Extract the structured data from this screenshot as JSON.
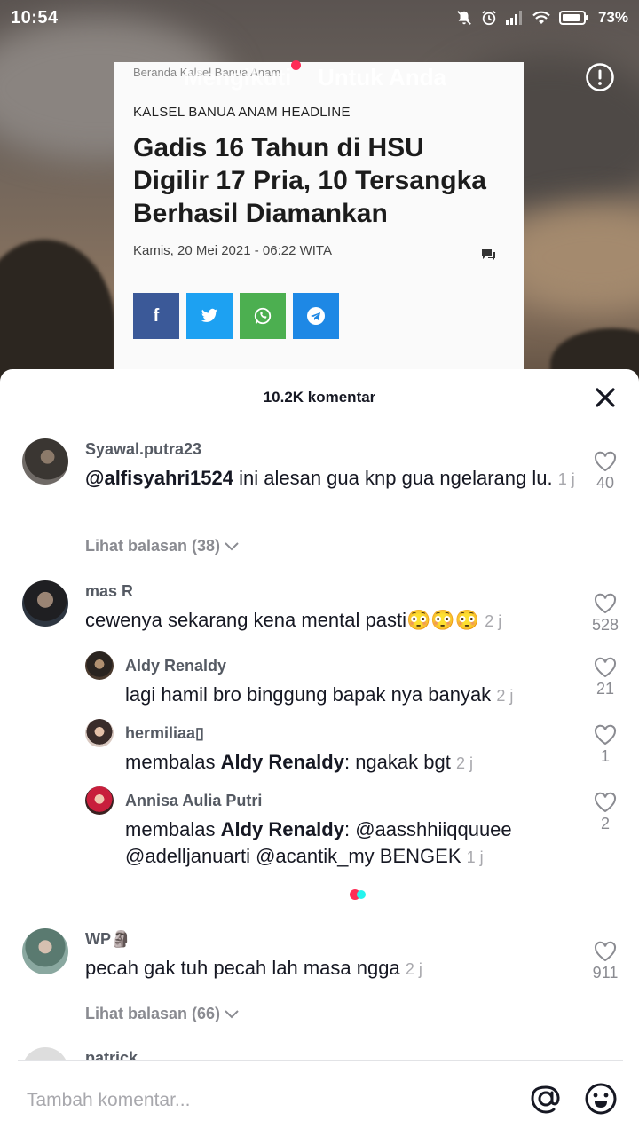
{
  "status_bar": {
    "time": "10:54",
    "battery": "73%",
    "icons": [
      "mute-icon",
      "alarm-icon",
      "signal-icon",
      "wifi-icon",
      "battery-icon"
    ]
  },
  "video": {
    "nav_following": "Mengikuti",
    "nav_for_you": "Untuk Anda",
    "article": {
      "breadcrumb": "Beranda  Kalsel  Banua Anam",
      "section": "KALSEL BANUA ANAM HEADLINE",
      "title": "Gadis 16 Tahun di HSU Digilir 17 Pria, 10 Tersangka Berhasil Diamankan",
      "date": "Kamis, 20 Mei 2021 - 06:22 WITA",
      "share_colors": {
        "facebook": "#3b5998",
        "twitter": "#1da1f2",
        "whatsapp": "#4caf50",
        "telegram": "#1e88e5"
      }
    }
  },
  "comments_sheet": {
    "count_label": "10.2K komentar",
    "comments": [
      {
        "user": "Syawal.putra23",
        "mention": "@alfisyahri1524",
        "text": " ini alesan gua knp gua ngelarang lu.",
        "time": "1 j",
        "likes": "40",
        "replies_label": "Lihat balasan (38)"
      },
      {
        "user": "mas R",
        "text": "cewenya sekarang kena mental pasti😳😳😳",
        "time": "2 j",
        "likes": "528",
        "replies": [
          {
            "user": "Aldy Renaldy",
            "text": "lagi hamil bro binggung bapak nya banyak",
            "time": "2 j",
            "likes": "21"
          },
          {
            "user": "hermiliaa▯",
            "prefix": "membalas ",
            "reply_to": "Aldy Renaldy",
            "text": ": ngakak bgt",
            "time": "2 j",
            "likes": "1"
          },
          {
            "user": "Annisa Aulia Putri",
            "prefix": "membalas ",
            "reply_to": "Aldy Renaldy",
            "text": ": @aasshhiiqquuee @adelljanuarti @acantik_my BENGEK",
            "time": "1 j",
            "likes": "2"
          }
        ]
      },
      {
        "user": "WP🗿",
        "text": "pecah gak tuh pecah lah masa ngga",
        "time": "2 j",
        "likes": "911",
        "replies_label": "Lihat balasan (66)"
      },
      {
        "user": "patrick"
      }
    ]
  },
  "input": {
    "placeholder": "Tambah komentar..."
  },
  "colors": {
    "accent_red": "#fe2c55",
    "accent_cyan": "#25f4ee",
    "muted_text": "#8a8b91"
  }
}
